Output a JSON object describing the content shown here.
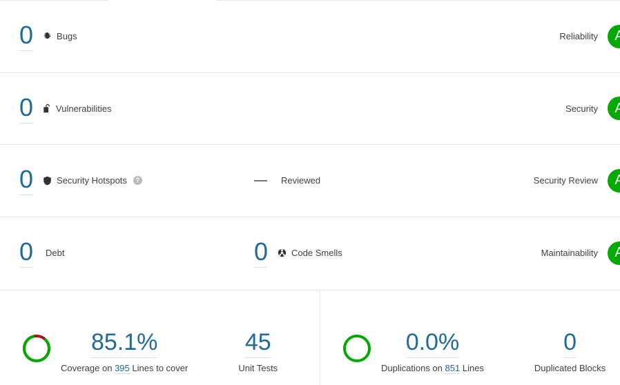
{
  "measures": [
    {
      "value": "0",
      "label": "Bugs",
      "icon": "bug-icon",
      "mid_value": null,
      "mid_label": null,
      "mid_icon": null,
      "has_help": false,
      "rating_name": "Reliability",
      "rating_letter": "A"
    },
    {
      "value": "0",
      "label": "Vulnerabilities",
      "icon": "open-padlock-icon",
      "mid_value": null,
      "mid_label": null,
      "mid_icon": null,
      "has_help": false,
      "rating_name": "Security",
      "rating_letter": "A"
    },
    {
      "value": "0",
      "label": "Security Hotspots",
      "icon": "shield-icon",
      "mid_value": "—",
      "mid_label": "Reviewed",
      "mid_icon": null,
      "has_help": true,
      "help_glyph": "?",
      "rating_name": "Security Review",
      "rating_letter": "A"
    },
    {
      "value": "0",
      "label": "Debt",
      "icon": null,
      "mid_value": "0",
      "mid_label": "Code Smells",
      "mid_icon": "code-smell-icon",
      "has_help": false,
      "rating_name": "Maintainability",
      "rating_letter": "A"
    }
  ],
  "coverage_panel": {
    "donut": {
      "percent": 85.1,
      "filled_color": "#00aa00",
      "remainder_color": "#a4161a"
    },
    "primary": {
      "value": "85.1%",
      "caption_prefix": "Coverage on",
      "caption_link": "395",
      "caption_suffix": "Lines to cover"
    },
    "secondary": {
      "value": "45",
      "caption": "Unit Tests"
    }
  },
  "duplications_panel": {
    "donut": {
      "percent": 0.0,
      "filled_color": "#00aa00",
      "remainder_color": "#00aa00"
    },
    "primary": {
      "value": "0.0%",
      "caption_prefix": "Duplications on",
      "caption_link": "851",
      "caption_suffix": "Lines"
    },
    "secondary": {
      "value": "0",
      "caption": "Duplicated Blocks"
    }
  },
  "colors": {
    "link_blue": "#236a97",
    "rating_green": "#00aa00",
    "divider": "#e6e6e6"
  }
}
